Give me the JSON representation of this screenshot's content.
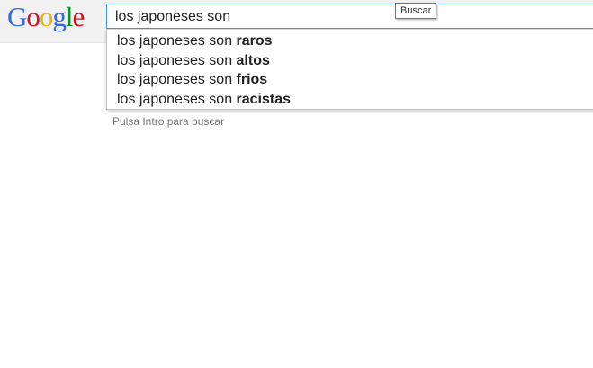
{
  "logo": {
    "text": "Google",
    "letters": [
      {
        "char": "G",
        "color": "#3369e8"
      },
      {
        "char": "o",
        "color": "#d50f25"
      },
      {
        "char": "o",
        "color": "#eeb211"
      },
      {
        "char": "g",
        "color": "#3369e8"
      },
      {
        "char": "l",
        "color": "#009925"
      },
      {
        "char": "e",
        "color": "#d50f25"
      }
    ]
  },
  "search": {
    "value": "los japoneses son",
    "focus_border_color": "#4d90fe"
  },
  "tooltip": {
    "label": "Buscar"
  },
  "suggestions": [
    {
      "prefix": "los japoneses son ",
      "completion": "raros"
    },
    {
      "prefix": "los japoneses son ",
      "completion": "altos"
    },
    {
      "prefix": "los japoneses son ",
      "completion": "frios"
    },
    {
      "prefix": "los japoneses son ",
      "completion": "racistas"
    }
  ],
  "hint": {
    "text": "Pulsa Intro para buscar"
  }
}
